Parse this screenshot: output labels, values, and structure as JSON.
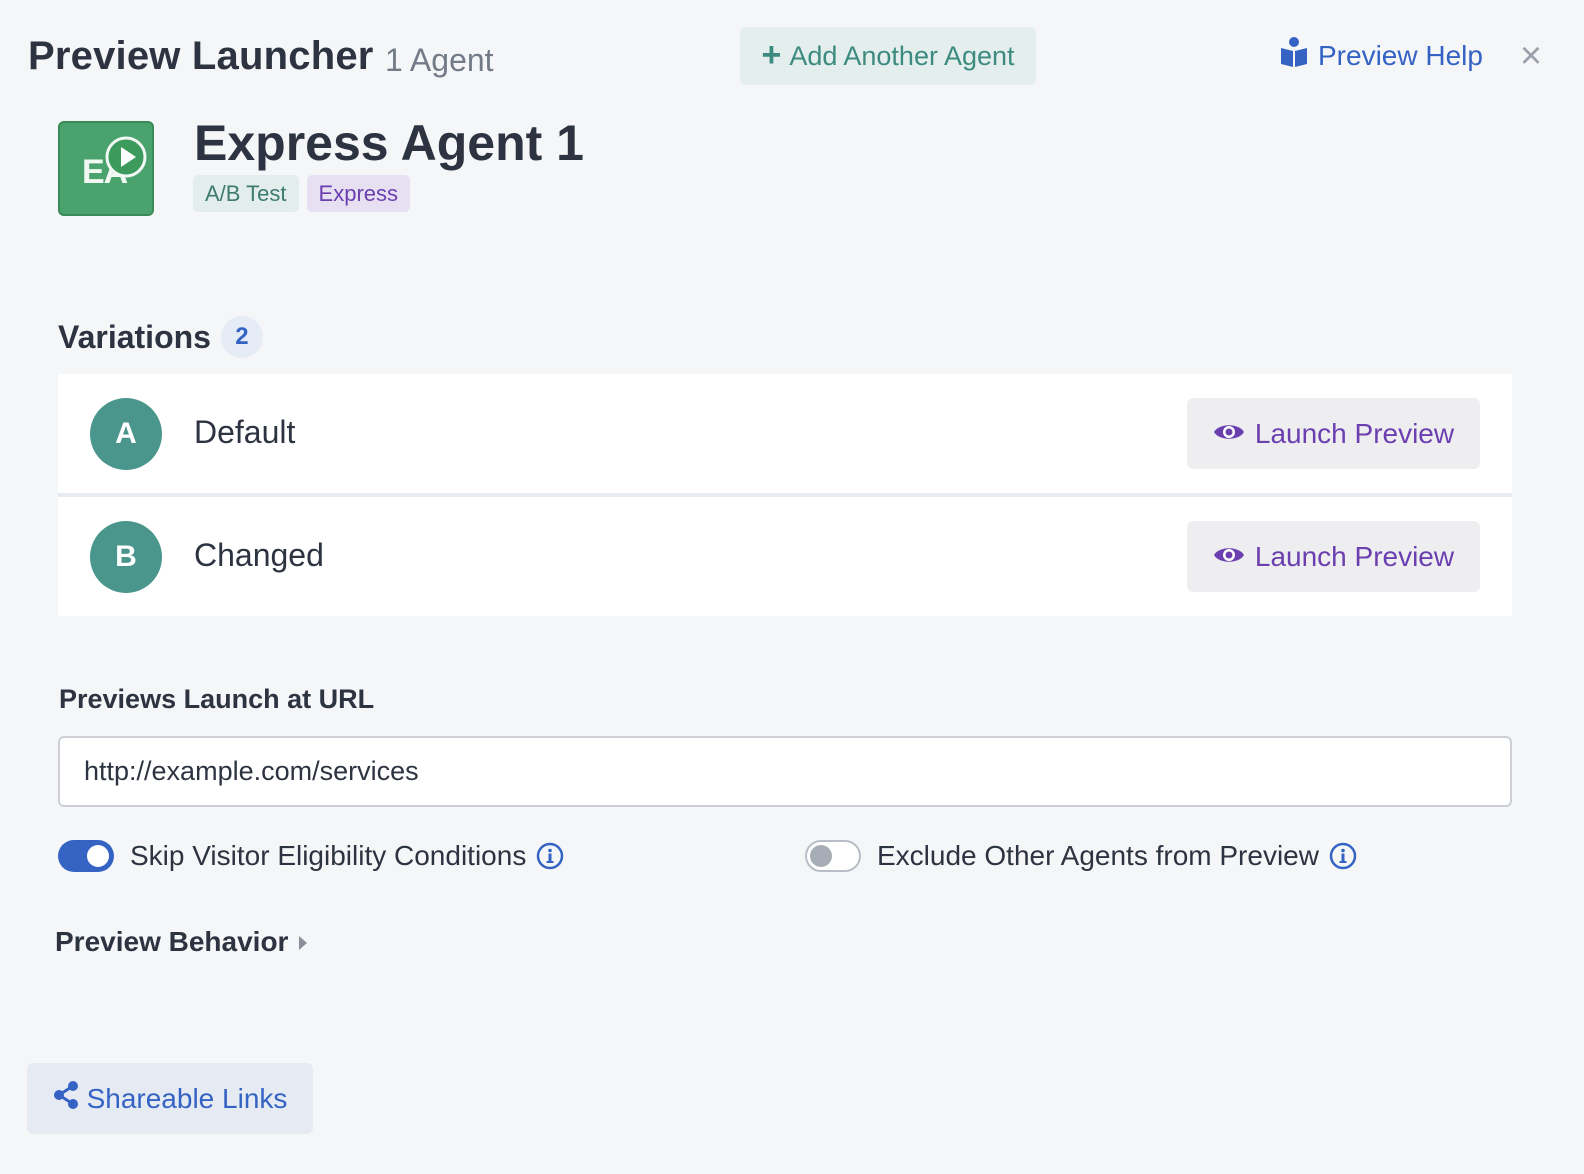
{
  "header": {
    "title": "Preview Launcher",
    "subtitle": "1 Agent",
    "add_agent_label": "Add Another Agent",
    "help_label": "Preview Help",
    "close_label": "×"
  },
  "agent": {
    "initials": "EA",
    "name": "Express Agent 1",
    "tags": [
      "A/B Test",
      "Express"
    ]
  },
  "variations": {
    "label": "Variations",
    "count": "2",
    "launch_label": "Launch Preview",
    "items": [
      {
        "letter": "A",
        "name": "Default"
      },
      {
        "letter": "B",
        "name": "Changed"
      }
    ]
  },
  "url": {
    "label": "Previews Launch at URL",
    "value": "http://example.com/services"
  },
  "toggles": {
    "skip_eligibility": {
      "label": "Skip Visitor Eligibility Conditions",
      "checked": true
    },
    "exclude_agents": {
      "label": "Exclude Other Agents from Preview",
      "checked": false
    }
  },
  "behavior": {
    "label": "Preview Behavior"
  },
  "share": {
    "label": "Shareable Links"
  },
  "colors": {
    "primary_blue": "#3563c4",
    "teal": "#4a968d",
    "purple": "#6b3fb0",
    "agent_green": "#4aa36c"
  },
  "icons": {
    "add": "plus-icon",
    "help": "book-reader-icon",
    "close": "close-icon",
    "play": "play-icon",
    "launch": "eye-icon",
    "info": "info-icon",
    "behavior": "caret-right-icon",
    "share": "share-icon"
  }
}
